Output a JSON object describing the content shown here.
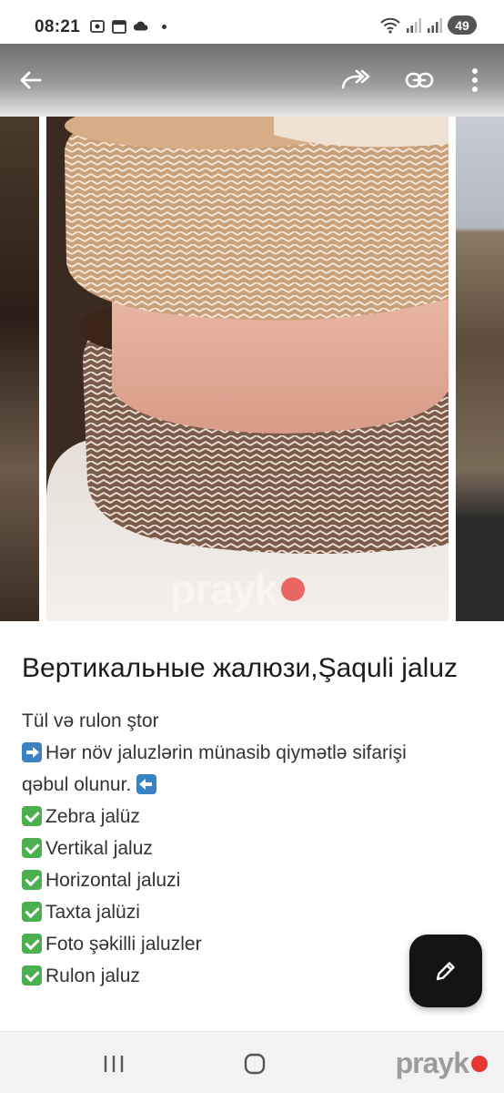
{
  "status_bar": {
    "time": "08:21",
    "battery": "49",
    "icons": [
      "screenshot-icon",
      "calendar-icon",
      "cloud-icon",
      "wifi-icon",
      "signal-icon",
      "signal-icon"
    ]
  },
  "toolbar": {
    "back_icon": "arrow-left-icon",
    "share_icon": "share-forward-icon",
    "link_icon": "link-icon",
    "more_icon": "more-vert-icon"
  },
  "gallery": {
    "photo_count_visible": 3,
    "progress_fraction": 0.28,
    "watermark": "prayk"
  },
  "listing": {
    "title": "Вертикальные жалюзи,Şaquli jaluz",
    "lines": [
      {
        "icon": "",
        "text": "Tül və rulon ştor"
      },
      {
        "icon": "arrow-right",
        "text": "Hər növ jaluzlərin münasib qiymətlə sifarişi"
      },
      {
        "icon": "",
        "text": "qəbul olunur.",
        "trail_icon": "arrow-left"
      },
      {
        "icon": "check",
        "text": "Zebra jalüz"
      },
      {
        "icon": "check",
        "text": "Vertikal jaluz"
      },
      {
        "icon": "check",
        "text": "Horizontal jaluzi"
      },
      {
        "icon": "check",
        "text": "Taxta jalüzi"
      },
      {
        "icon": "check",
        "text": "Foto şəkilli jaluzler"
      },
      {
        "icon": "check",
        "text": "Rulon jaluz"
      }
    ]
  },
  "fab": {
    "icon": "pencil-icon"
  },
  "nav_bar": {
    "recents_icon": "recents-icon",
    "home_icon": "home-icon",
    "watermark": "prayk"
  },
  "colors": {
    "fab_background": "#141414",
    "check_green": "#4caf50",
    "arrow_blue": "#3b82c4",
    "brand_red": "#e53935"
  }
}
